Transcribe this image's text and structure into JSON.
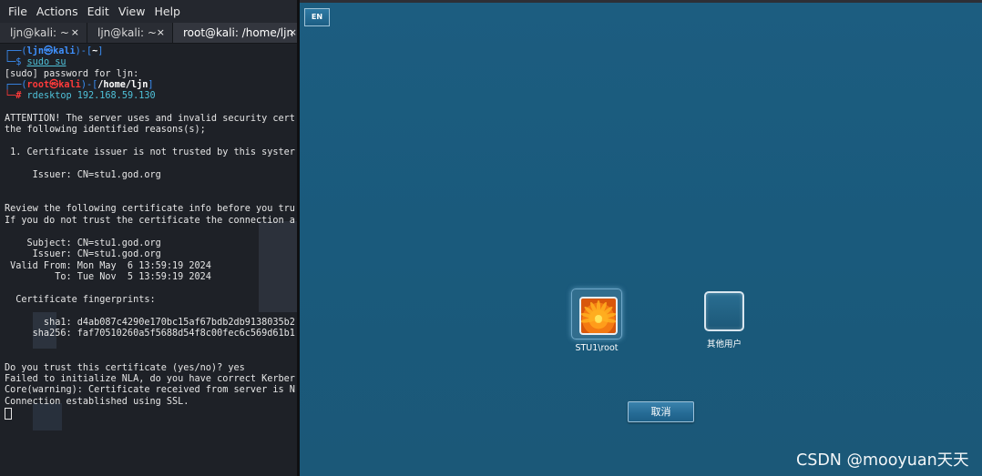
{
  "menubar": {
    "items": [
      "File",
      "Actions",
      "Edit",
      "View",
      "Help"
    ]
  },
  "tabs": [
    {
      "label": "ljn@kali: ~",
      "close": "×"
    },
    {
      "label": "ljn@kali: ~",
      "close": "×"
    },
    {
      "label": "root@kali: /home/ljn",
      "close": "×"
    }
  ],
  "terminal": {
    "prompt1_frame": "┌──(",
    "prompt1_user": "ljn㉿kali",
    "prompt1_mid": ")-[",
    "prompt1_dir": "~",
    "prompt1_end": "]",
    "prompt1_dollar": "└─$ ",
    "cmd1": "sudo su",
    "sudo_prompt": "[sudo] password for ljn:",
    "prompt2_frame": "┌──(",
    "prompt2_user": "root㉿kali",
    "prompt2_mid": ")-[",
    "prompt2_dir": "/home/ljn",
    "prompt2_end": "]",
    "prompt2_hash": "└─# ",
    "cmd2": "rdesktop 192.168.59.130",
    "lines": [
      "ATTENTION! The server uses and invalid security cert",
      "the following identified reasons(s);",
      " 1. Certificate issuer is not trusted by this syster",
      "     Issuer: CN=stu1.god.org",
      "Review the following certificate info before you tru",
      "If you do not trust the certificate the connection a",
      "    Subject: CN=stu1.god.org",
      "     Issuer: CN=stu1.god.org",
      " Valid From: Mon May  6 13:59:19 2024",
      "         To: Tue Nov  5 13:59:19 2024",
      "  Certificate fingerprints:",
      "       sha1: d4ab087c4290e170bc15af67bdb2db9138035b2",
      "     sha256: faf70510260a5f5688d54f8c00fec6c569d61b1",
      "Do you trust this certificate (yes/no)? yes",
      "Failed to initialize NLA, do you have correct Kerber",
      "Core(warning): Certificate received from server is N",
      "Connection established using SSL."
    ]
  },
  "rdp": {
    "lang_button": "EN",
    "users": [
      {
        "label": "STU1\\root"
      },
      {
        "label": "其他用户"
      }
    ],
    "cancel_label": "取消"
  },
  "watermark": "CSDN @mooyuan天天"
}
